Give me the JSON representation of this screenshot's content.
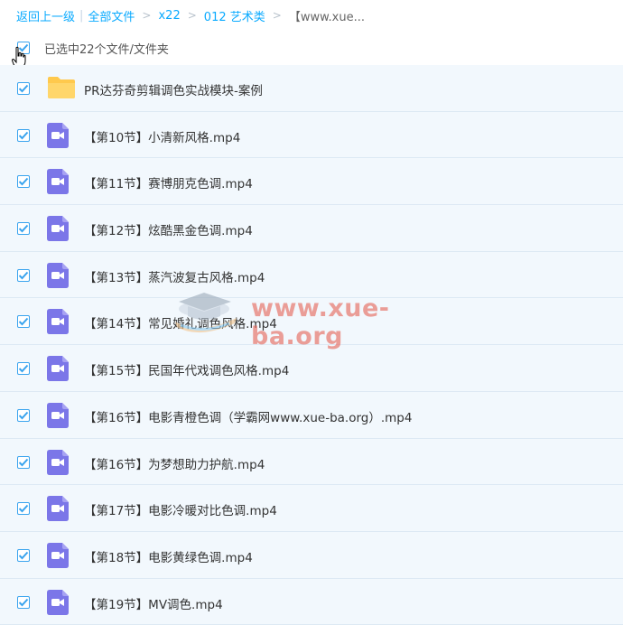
{
  "breadcrumb": {
    "back": "返回上一级",
    "all_files": "全部文件",
    "path": [
      "x22",
      "012 艺术类"
    ],
    "current": "【www.xue..."
  },
  "selection": {
    "text": "已选中22个文件/文件夹",
    "checked": true
  },
  "files": [
    {
      "type": "folder",
      "name": "PR达芬奇剪辑调色实战模块-案例",
      "checked": true,
      "icon": "folder-icon"
    },
    {
      "type": "video",
      "name": "【第10节】小清新风格.mp4",
      "checked": true,
      "icon": "video-file-icon"
    },
    {
      "type": "video",
      "name": "【第11节】赛博朋克色调.mp4",
      "checked": true,
      "icon": "video-file-icon"
    },
    {
      "type": "video",
      "name": "【第12节】炫酷黑金色调.mp4",
      "checked": true,
      "icon": "video-file-icon"
    },
    {
      "type": "video",
      "name": "【第13节】蒸汽波复古风格.mp4",
      "checked": true,
      "icon": "video-file-icon"
    },
    {
      "type": "video",
      "name": "【第14节】常见婚礼调色风格.mp4",
      "checked": true,
      "icon": "video-file-icon"
    },
    {
      "type": "video",
      "name": "【第15节】民国年代戏调色风格.mp4",
      "checked": true,
      "icon": "video-file-icon"
    },
    {
      "type": "video",
      "name": "【第16节】电影青橙色调（学霸网www.xue-ba.org）.mp4",
      "checked": true,
      "icon": "video-file-icon"
    },
    {
      "type": "video",
      "name": "【第16节】为梦想助力护航.mp4",
      "checked": true,
      "icon": "video-file-icon"
    },
    {
      "type": "video",
      "name": "【第17节】电影冷暖对比色调.mp4",
      "checked": true,
      "icon": "video-file-icon"
    },
    {
      "type": "video",
      "name": "【第18节】电影黄绿色调.mp4",
      "checked": true,
      "icon": "video-file-icon"
    },
    {
      "type": "video",
      "name": "【第19节】MV调色.mp4",
      "checked": true,
      "icon": "video-file-icon"
    }
  ],
  "watermark": {
    "text": "www.xue-ba.org",
    "icon": "graduation-cap-icon"
  },
  "colors": {
    "link": "#09aaff",
    "row_bg": "#f2f8fd",
    "checkbox": "#3aa4ee",
    "video_icon": "#7b76e8",
    "folder_icon": "#ffc94d",
    "watermark": "#e66a5e"
  }
}
